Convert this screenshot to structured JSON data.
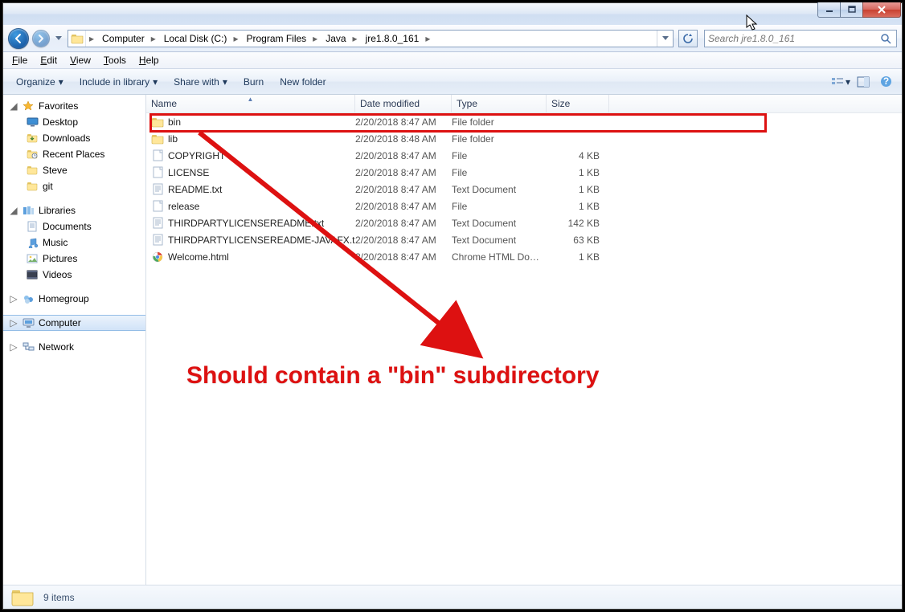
{
  "window": {
    "title": ""
  },
  "nav": {
    "crumbs": [
      "Computer",
      "Local Disk (C:)",
      "Program Files",
      "Java",
      "jre1.8.0_161"
    ]
  },
  "search": {
    "placeholder": "Search jre1.8.0_161"
  },
  "menubar": [
    "File",
    "Edit",
    "View",
    "Tools",
    "Help"
  ],
  "toolbar": {
    "organize": "Organize",
    "include": "Include in library",
    "share": "Share with",
    "burn": "Burn",
    "newfolder": "New folder"
  },
  "sidebar": {
    "favorites": {
      "label": "Favorites",
      "items": [
        "Desktop",
        "Downloads",
        "Recent Places",
        "Steve",
        "git"
      ]
    },
    "libraries": {
      "label": "Libraries",
      "items": [
        "Documents",
        "Music",
        "Pictures",
        "Videos"
      ]
    },
    "homegroup": {
      "label": "Homegroup"
    },
    "computer": {
      "label": "Computer"
    },
    "network": {
      "label": "Network"
    }
  },
  "columns": {
    "name": "Name",
    "date": "Date modified",
    "type": "Type",
    "size": "Size"
  },
  "files": [
    {
      "icon": "folder",
      "name": "bin",
      "date": "2/20/2018 8:47 AM",
      "type": "File folder",
      "size": ""
    },
    {
      "icon": "folder",
      "name": "lib",
      "date": "2/20/2018 8:48 AM",
      "type": "File folder",
      "size": ""
    },
    {
      "icon": "file",
      "name": "COPYRIGHT",
      "date": "2/20/2018 8:47 AM",
      "type": "File",
      "size": "4 KB"
    },
    {
      "icon": "file",
      "name": "LICENSE",
      "date": "2/20/2018 8:47 AM",
      "type": "File",
      "size": "1 KB"
    },
    {
      "icon": "text",
      "name": "README.txt",
      "date": "2/20/2018 8:47 AM",
      "type": "Text Document",
      "size": "1 KB"
    },
    {
      "icon": "file",
      "name": "release",
      "date": "2/20/2018 8:47 AM",
      "type": "File",
      "size": "1 KB"
    },
    {
      "icon": "text",
      "name": "THIRDPARTYLICENSEREADME.txt",
      "date": "2/20/2018 8:47 AM",
      "type": "Text Document",
      "size": "142 KB"
    },
    {
      "icon": "text",
      "name": "THIRDPARTYLICENSEREADME-JAVAFX.txt",
      "date": "2/20/2018 8:47 AM",
      "type": "Text Document",
      "size": "63 KB"
    },
    {
      "icon": "chrome",
      "name": "Welcome.html",
      "date": "2/20/2018 8:47 AM",
      "type": "Chrome HTML Do…",
      "size": "1 KB"
    }
  ],
  "status": {
    "count_text": "9 items"
  },
  "annotation": {
    "text": "Should contain a \"bin\" subdirectory"
  },
  "icons": {
    "star": "star-icon",
    "desktop": "desktop-icon",
    "dl": "downloads-icon",
    "recent": "recent-icon",
    "user": "user-folder-icon",
    "git": "git-folder-icon",
    "libs": "libraries-icon",
    "doc": "documents-icon",
    "music": "music-icon",
    "pics": "pictures-icon",
    "vids": "videos-icon",
    "home": "homegroup-icon",
    "comp": "computer-icon",
    "net": "network-icon"
  }
}
